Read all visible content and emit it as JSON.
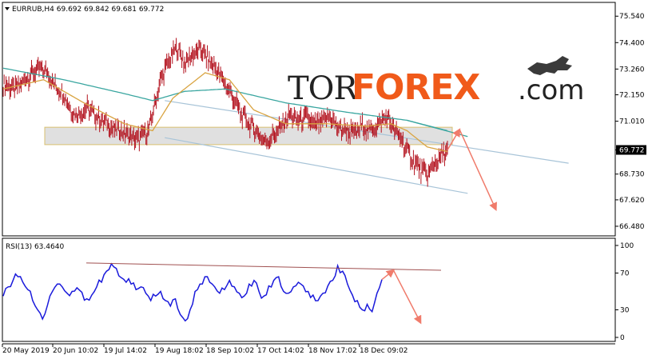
{
  "chart_data": [
    {
      "type": "candlestick",
      "title": "EURRUB,H4  69.692 69.842 69.681 69.772",
      "current_price": 69.772,
      "current_price_label": "69.772",
      "ylim": [
        66.1,
        76.1
      ],
      "y_ticks": [
        "75.540",
        "74.400",
        "73.260",
        "72.150",
        "71.010",
        "69.772",
        "68.730",
        "67.620",
        "66.480"
      ],
      "y_tick_values": [
        75.54,
        74.4,
        73.26,
        72.15,
        71.01,
        69.772,
        68.73,
        67.62,
        66.48
      ],
      "x_ticks": [
        "20 May 2019",
        "20 Jun 10:02",
        "19 Jul 14:02",
        "19 Aug 18:02",
        "18 Sep 10:02",
        "17 Oct 14:02",
        "18 Nov 17:02",
        "18 Dec 09:02"
      ],
      "price_path": [
        [
          0,
          72.6
        ],
        [
          3,
          72.4
        ],
        [
          6,
          72.9
        ],
        [
          9,
          73.3
        ],
        [
          11,
          73.1
        ],
        [
          13,
          72.5
        ],
        [
          15,
          72.2
        ],
        [
          17,
          71.4
        ],
        [
          19,
          71.3
        ],
        [
          21,
          71.6
        ],
        [
          23,
          71.2
        ],
        [
          25,
          71.0
        ],
        [
          27,
          70.7
        ],
        [
          29,
          70.6
        ],
        [
          31,
          70.4
        ],
        [
          33,
          70.2
        ],
        [
          36,
          70.6
        ],
        [
          39,
          72.8
        ],
        [
          41,
          73.6
        ],
        [
          43,
          74.2
        ],
        [
          45,
          73.5
        ],
        [
          47,
          73.9
        ],
        [
          49,
          74.1
        ],
        [
          51,
          73.6
        ],
        [
          53,
          73.2
        ],
        [
          55,
          72.6
        ],
        [
          57,
          72.0
        ],
        [
          59,
          71.3
        ],
        [
          61,
          70.9
        ],
        [
          63,
          70.5
        ],
        [
          65,
          70.1
        ],
        [
          67,
          70.4
        ],
        [
          69,
          70.8
        ],
        [
          71,
          71.3
        ],
        [
          73,
          71.0
        ],
        [
          75,
          71.2
        ],
        [
          77,
          70.8
        ],
        [
          79,
          71.0
        ],
        [
          81,
          71.2
        ],
        [
          83,
          70.7
        ],
        [
          85,
          70.6
        ],
        [
          87,
          70.5
        ],
        [
          89,
          70.8
        ],
        [
          91,
          70.6
        ],
        [
          93,
          70.9
        ],
        [
          95,
          71.2
        ],
        [
          97,
          70.6
        ],
        [
          99,
          70.1
        ],
        [
          101,
          69.4
        ],
        [
          103,
          69.0
        ],
        [
          105,
          68.7
        ],
        [
          107,
          69.2
        ],
        [
          110,
          69.77
        ]
      ],
      "ma_fast": [
        [
          0,
          72.4
        ],
        [
          10,
          72.8
        ],
        [
          20,
          71.8
        ],
        [
          30,
          70.9
        ],
        [
          37,
          70.6
        ],
        [
          42,
          72.0
        ],
        [
          50,
          73.1
        ],
        [
          56,
          72.8
        ],
        [
          62,
          71.5
        ],
        [
          70,
          70.9
        ],
        [
          80,
          70.9
        ],
        [
          90,
          70.8
        ],
        [
          96,
          70.9
        ],
        [
          100,
          70.6
        ],
        [
          105,
          69.9
        ],
        [
          110,
          69.7
        ]
      ],
      "ma_slow": [
        [
          0,
          73.3
        ],
        [
          15,
          72.8
        ],
        [
          30,
          72.2
        ],
        [
          37,
          71.9
        ],
        [
          45,
          72.3
        ],
        [
          55,
          72.4
        ],
        [
          70,
          71.8
        ],
        [
          85,
          71.4
        ],
        [
          100,
          71.05
        ],
        [
          110,
          70.6
        ]
      ],
      "support_zone": [
        70.0,
        70.75
      ],
      "channel_upper": [
        [
          40,
          71.9
        ],
        [
          140,
          69.2
        ]
      ],
      "channel_lower": [
        [
          40,
          70.3
        ],
        [
          115,
          67.9
        ]
      ],
      "forecast": [
        [
          110,
          69.77
        ],
        [
          113,
          70.65
        ],
        [
          122,
          67.2
        ]
      ]
    },
    {
      "type": "line",
      "title": "RSI(13) 63.4640",
      "ylim": [
        0,
        100
      ],
      "y_ticks": [
        "100",
        "70",
        "30",
        "0"
      ],
      "y_tick_values": [
        100,
        70,
        30,
        0
      ],
      "values": [
        45,
        55,
        62,
        66,
        60,
        52,
        40,
        30,
        20,
        35,
        50,
        58,
        55,
        48,
        50,
        54,
        49,
        42,
        46,
        55,
        60,
        72,
        80,
        75,
        65,
        60,
        58,
        52,
        55,
        48,
        40,
        45,
        50,
        40,
        34,
        42,
        25,
        18,
        30,
        50,
        58,
        66,
        60,
        55,
        48,
        52,
        62,
        55,
        48,
        45,
        58,
        62,
        50,
        45,
        56,
        62,
        66,
        50,
        48,
        55,
        60,
        56,
        50,
        46,
        40,
        48,
        56,
        62,
        78,
        72,
        58,
        46,
        40,
        30,
        36,
        28,
        48,
        63
      ],
      "resistance_line": [
        [
          0,
          81
        ],
        [
          100,
          73
        ]
      ],
      "forecast": [
        [
          98,
          63
        ],
        [
          101,
          73
        ],
        [
          108,
          16
        ]
      ]
    }
  ],
  "logo": {
    "tor": "TOR",
    "forex": "FOREX",
    "com": ".com",
    "forex_color": "#f05a1a"
  },
  "colors": {
    "ma_fast": "#d9a441",
    "ma_slow": "#3aa6a0",
    "candle": "#b3121e",
    "rsi": "#1a1adb",
    "arrow": "#f07b6b",
    "channel": "#a8c4d8",
    "zone": "#d8d8d8",
    "zone_border": "#d9c070"
  }
}
